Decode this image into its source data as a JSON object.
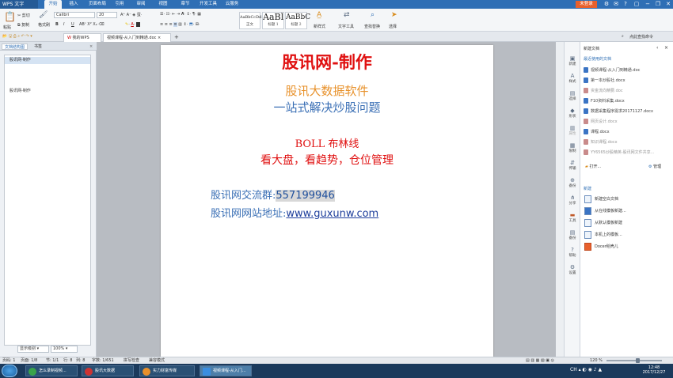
{
  "titlebar": {
    "app": "WPS 文字",
    "tabs": [
      "开始",
      "插入",
      "页面布局",
      "引用",
      "审阅",
      "视图",
      "章节",
      "开发工具",
      "云服务"
    ],
    "login": "未登录"
  },
  "ribbon": {
    "paste": "粘贴",
    "cut": "剪切",
    "copy": "复制",
    "format_painter": "格式刷",
    "font": "Calibri",
    "size": "20",
    "bold": "B",
    "italic": "I",
    "underline": "U",
    "styles": [
      {
        "sample": "AaBbCcDd",
        "label": "正文"
      },
      {
        "sample": "AaBl",
        "label": "标题 1"
      },
      {
        "sample": "AaBbC",
        "label": "标题 2"
      }
    ],
    "new_style": "新样式",
    "text_tools": "文字工具",
    "find_replace": "查找替换",
    "select": "选择"
  },
  "tabs": {
    "home": "我的WPS",
    "doc": "视频课程-从入门到精通.doc",
    "search_hint": "点此查找命令"
  },
  "nav": {
    "tabs": [
      "文档结构图",
      "书签"
    ],
    "items": [
      "股讯网-制作",
      "股讯网-制作"
    ],
    "level_label": "显示级别",
    "zoom": "100%"
  },
  "document": {
    "title": "股讯网-制作",
    "line1": "股讯大数据软件",
    "line2": "一站式解决炒股问题",
    "line3": "BOLL 布林线",
    "line4": "看大盘，看趋势，仓位管理",
    "qq_label": "股讯网交流群:",
    "qq_value": "557199946",
    "site_label": "股讯网网站地址:",
    "site_value": "www.guxunw.com"
  },
  "vtools": [
    "新建",
    "样式",
    "选择",
    "形状",
    "属性",
    "限制",
    "传输",
    "备份",
    "分享",
    "工具",
    "备份",
    "帮助",
    "设置"
  ],
  "taskpane": {
    "header": "新建文档",
    "recent_title": "最近使用的文档",
    "recent": [
      "视频课程-从入门到精通.doc",
      "第一本炒股社.docx",
      "资金流向精要.doc",
      "F10资料采集.docx",
      "数据采集程序需求20171127.docx",
      "网页设计.docx",
      "课程.docx",
      "知识课程.docx",
      "YY6565炒股精英-股讯网文件共享..."
    ],
    "open": "打开...",
    "manage": "管理",
    "new_title": "新建",
    "new_items": [
      "新建空白文档",
      "从在线模板新建...",
      "从默认模板新建",
      "本机上的模板...",
      "Docer稻壳儿"
    ]
  },
  "status": {
    "page": "页码: 1",
    "pages": "页面: 1/8",
    "section": "节: 1/1",
    "row": "行: 8",
    "col": "列: 8",
    "words": "字数: 1/651",
    "spell": "拼写检查",
    "compat": "兼容模式",
    "zoom": "120 %"
  },
  "taskbar": {
    "items": [
      "怎么录制视频...",
      "股讯大数据",
      "实力财富传媒",
      "视频课程-从入门..."
    ],
    "time": "12:48",
    "date": "2017/12/27"
  }
}
